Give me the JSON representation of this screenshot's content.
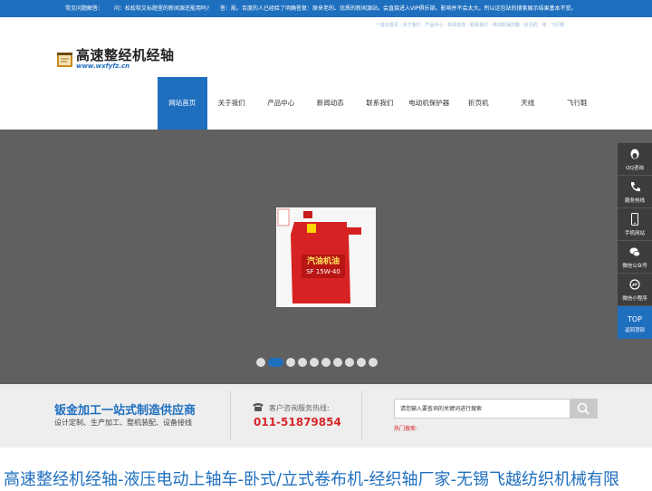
{
  "topbar": {
    "faq_label": "常见问题解答：",
    "q": "问：松松软文标题里的新闻源还能用吗?",
    "a": "答：能。百度的人已经给了明确答复：原来老的、优质的新闻源站。会直接进入VIP俱乐部。影响并不会太大。所以这包站的搜索展示结果基本不变。"
  },
  "sub_links": "一首台首页 · 关于我们 · 产品中心 · 新闻动态 · 联系我们 · 电动机保护器 · 折页机 · 线 · 飞行鞋",
  "logo": {
    "title": "高速整经机经轴",
    "url": "www.wxfyfz.cn"
  },
  "nav": [
    {
      "label": "网站首页",
      "active": true
    },
    {
      "label": "关于我们"
    },
    {
      "label": "产品中心"
    },
    {
      "label": "新闻动态"
    },
    {
      "label": "联系我们"
    },
    {
      "label": "电动机保护器"
    },
    {
      "label": "折页机"
    },
    {
      "label": "天线"
    },
    {
      "label": "飞行鞋"
    }
  ],
  "banner": {
    "product_label": "汽油机油",
    "product_spec": "SF 15W-40",
    "dots_count": 10,
    "active_dot": 2
  },
  "info": {
    "slogan": "钣金加工一站式制造供应商",
    "slogan_sub": "设计定制、生产加工、整机装配、设备接线",
    "hotline_label": "客户咨询服务热线:",
    "hotline": "011-51879854",
    "search_placeholder": "请您输入要查询的关键词进行搜索",
    "hot_search": "热门搜索:"
  },
  "headline": "高速整经机经轴-液压电动上轴车-卧式/立式卷布机-经织轴厂家-无锡飞越纺织机械有限",
  "side": {
    "items": [
      {
        "label": "QQ咨询",
        "icon": "penguin-icon"
      },
      {
        "label": "服务热线",
        "icon": "phone-free-icon"
      },
      {
        "label": "手机网站",
        "icon": "mobile-icon"
      },
      {
        "label": "微信公众号",
        "icon": "wechat-icon"
      },
      {
        "label": "微信小程序",
        "icon": "miniprogram-icon"
      }
    ],
    "top_label": "TOP",
    "top_sub": "返回顶部"
  },
  "colors": {
    "brand": "#1f6fbf",
    "accent_red": "#d8262b",
    "banner_bg": "#606060"
  }
}
